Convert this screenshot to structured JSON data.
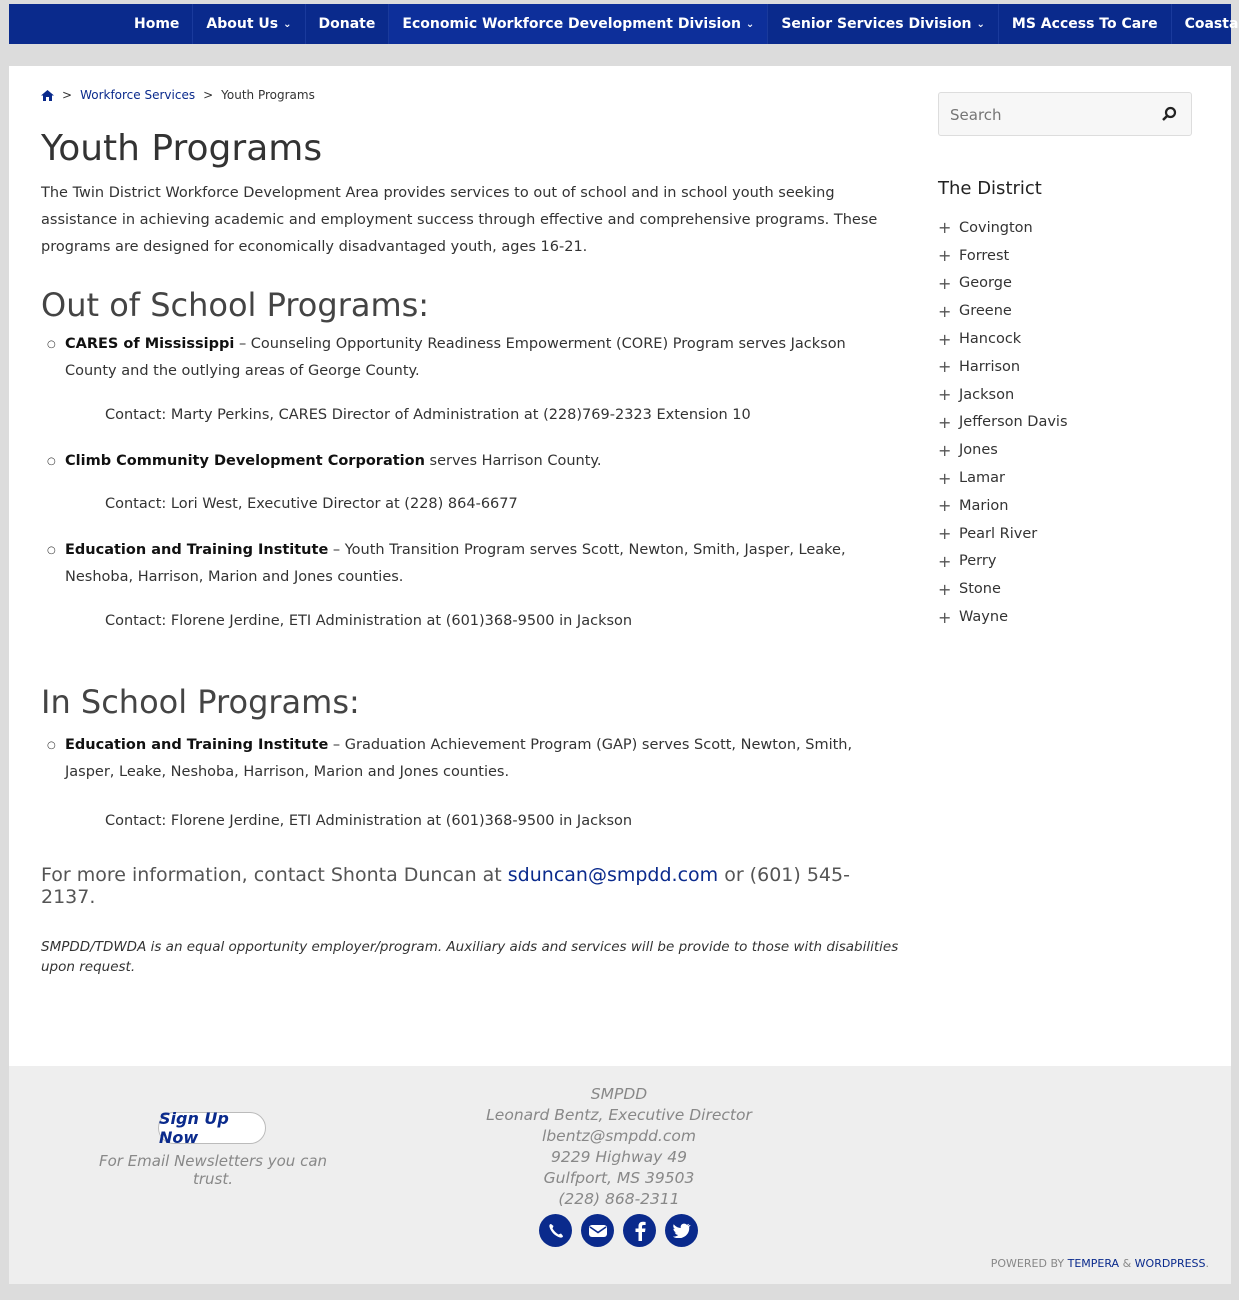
{
  "nav": {
    "items": [
      {
        "label": "Home",
        "dropdown": false
      },
      {
        "label": "About Us",
        "dropdown": true
      },
      {
        "label": "Donate",
        "dropdown": false
      },
      {
        "label": "Economic Workforce Development Division",
        "dropdown": true
      },
      {
        "label": "Senior Services Division",
        "dropdown": true
      },
      {
        "label": "MS Access To Care",
        "dropdown": false
      },
      {
        "label": "Coastal Map",
        "dropdown": false
      }
    ],
    "bg_color": "#0a2a8c"
  },
  "breadcrumb": {
    "home_icon": "home-icon",
    "separator": ">",
    "parent": "Workforce Services",
    "current": "Youth Programs"
  },
  "page": {
    "title": "Youth Programs",
    "intro": "The Twin District Workforce Development Area provides services to out of school and in school youth seeking assistance in achieving academic and employment success through effective and comprehensive programs. These programs are designed for economically disadvantaged youth, ages 16-21."
  },
  "out_of_school": {
    "heading": "Out of School Programs:",
    "programs": [
      {
        "name": "CARES of Mississippi",
        "desc": " – Counseling Opportunity Readiness Empowerment (CORE) Program serves Jackson County and the outlying areas of George County.",
        "contact": "Contact: Marty Perkins, CARES Director of Administration at (228)769-2323 Extension 10"
      },
      {
        "name": "Climb Community Development Corporation",
        "desc": " serves Harrison County.",
        "contact": "Contact: Lori West, Executive Director at (228) 864-6677"
      },
      {
        "name": "Education and Training Institute",
        "desc": " – Youth Transition Program serves Scott, Newton, Smith, Jasper, Leake, Neshoba, Harrison, Marion and Jones counties.",
        "contact": "Contact: Florene Jerdine, ETI Administration at (601)368-9500 in Jackson"
      }
    ]
  },
  "in_school": {
    "heading": "In School Programs:",
    "programs": [
      {
        "name": "Education and Training Institute",
        "desc": " – Graduation Achievement Program (GAP) serves Scott, Newton, Smith, Jasper, Leake, Neshoba, Harrison, Marion and Jones counties.",
        "contact": "Contact: Florene Jerdine, ETI Administration at (601)368-9500 in Jackson"
      }
    ]
  },
  "more_info": {
    "prefix": "For more information, contact Shonta Duncan at ",
    "email": "sduncan@smpdd.com",
    "suffix": " or (601) 545-2137."
  },
  "eeo_notice": "SMPDD/TDWDA is an equal opportunity employer/program. Auxiliary aids and services will be provide to those with disabilities upon request.",
  "sidebar": {
    "search_placeholder": "Search",
    "district_title": "The District",
    "counties": [
      "Covington",
      "Forrest",
      "George",
      "Greene",
      "Hancock",
      "Harrison",
      "Jackson",
      "Jefferson Davis",
      "Jones",
      "Lamar",
      "Marion",
      "Pearl River",
      "Perry",
      "Stone",
      "Wayne"
    ]
  },
  "footer": {
    "signup_label": "Sign Up Now",
    "signup_note": "For Email Newsletters you can trust.",
    "org": "SMPDD",
    "director": "Leonard Bentz, Executive Director",
    "email": "lbentz@smpdd.com",
    "street": "9229 Highway 49",
    "city": "Gulfport, MS 39503",
    "phone": "(228) 868-2311",
    "social_icons": [
      "phone-icon",
      "mail-icon",
      "facebook-icon",
      "twitter-icon"
    ],
    "powered_prefix": "POWERED BY ",
    "powered_theme": "TEMPERA",
    "powered_amp": " & ",
    "powered_cms": "WORDPRESS",
    "powered_dot": "."
  }
}
